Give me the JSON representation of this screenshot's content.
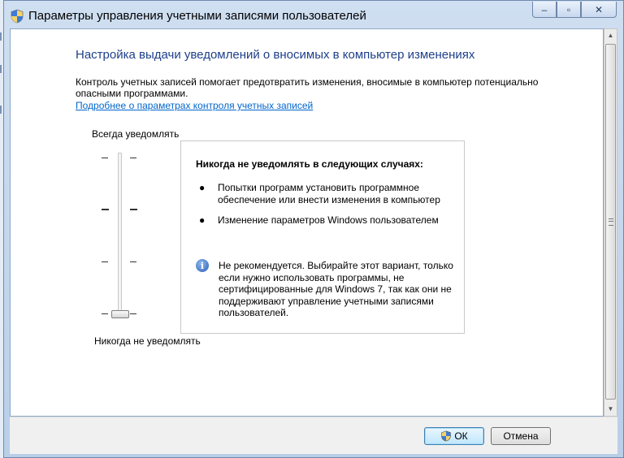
{
  "window": {
    "title": "Параметры управления учетными записями пользователей"
  },
  "caption_buttons": {
    "minimize": "–",
    "maximize": "▫",
    "close": "✕"
  },
  "main": {
    "heading": "Настройка выдачи уведомлений о вносимых в компьютер изменениях",
    "description": "Контроль учетных записей помогает предотвратить изменения, вносимые в компьютер потенциально опасными программами.",
    "link": "Подробнее о параметрах контроля учетных записей"
  },
  "slider": {
    "top_label": "Всегда уведомлять",
    "bottom_label": "Никогда не уведомлять",
    "levels": 4,
    "selected_level": 1
  },
  "infobox": {
    "title": "Никогда не уведомлять в следующих случаях:",
    "bullets": [
      "Попытки программ установить программное обеспечение или внести изменения в компьютер",
      "Изменение параметров Windows пользователем"
    ],
    "note": "Не рекомендуется. Выбирайте этот вариант, только если нужно использовать программы, не сертифицированные для Windows 7, так как они не поддерживают управление учетными записями пользователей.",
    "note_icon": "i"
  },
  "buttons": {
    "ok": "ОК",
    "cancel": "Отмена"
  },
  "colors": {
    "heading": "#1e3f8a",
    "link": "#0066cc"
  }
}
